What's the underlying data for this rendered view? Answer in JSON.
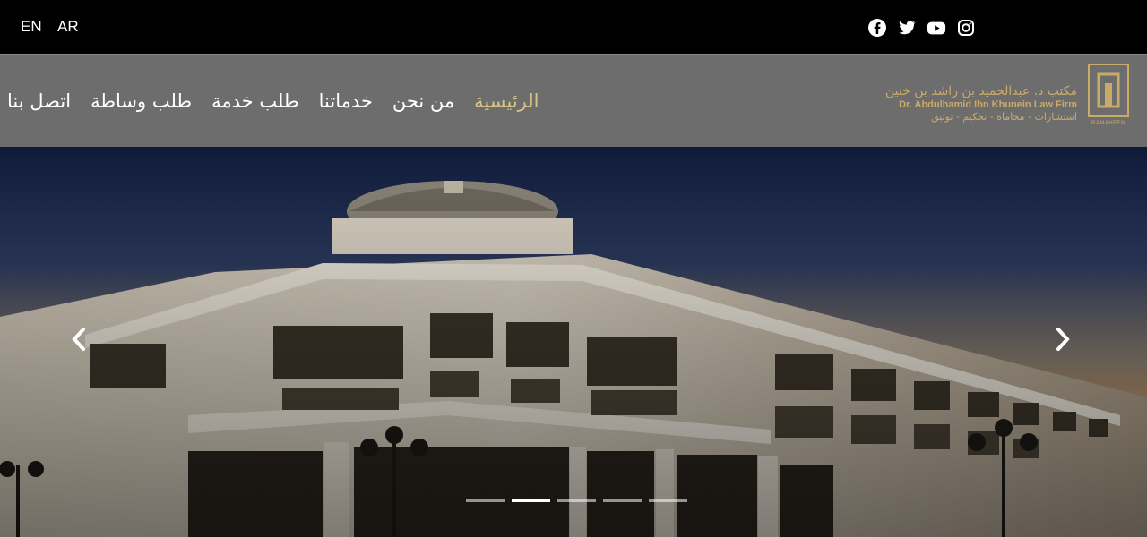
{
  "topbar": {
    "lang_en": "EN",
    "lang_ar": "AR",
    "socials": [
      "facebook-icon",
      "twitter-icon",
      "youtube-icon",
      "instagram-icon"
    ]
  },
  "nav": {
    "items": [
      {
        "label": "الرئيسية",
        "active": true
      },
      {
        "label": "من نحن",
        "active": false
      },
      {
        "label": "خدماتنا",
        "active": false
      },
      {
        "label": "طلب خدمة",
        "active": false
      },
      {
        "label": "طلب وساطة",
        "active": false
      },
      {
        "label": "اتصل بنا",
        "active": false
      }
    ]
  },
  "brand": {
    "name_ar": "مكتب د. عبدالحميد بن راشد بن خنين",
    "name_en": "Dr. Abdulhamid Ibn Khunein Law Firm",
    "tagline_ar": "استشارات - محاماة - تحكيم - توثيق",
    "logo_caption": "RAMAHEEN",
    "accent": "#c9aa69"
  },
  "carousel": {
    "slides": 5,
    "active_index": 1
  },
  "colors": {
    "topbar": "#000000",
    "navbar": "#6d6d6d",
    "active_link": "#d7c286"
  }
}
